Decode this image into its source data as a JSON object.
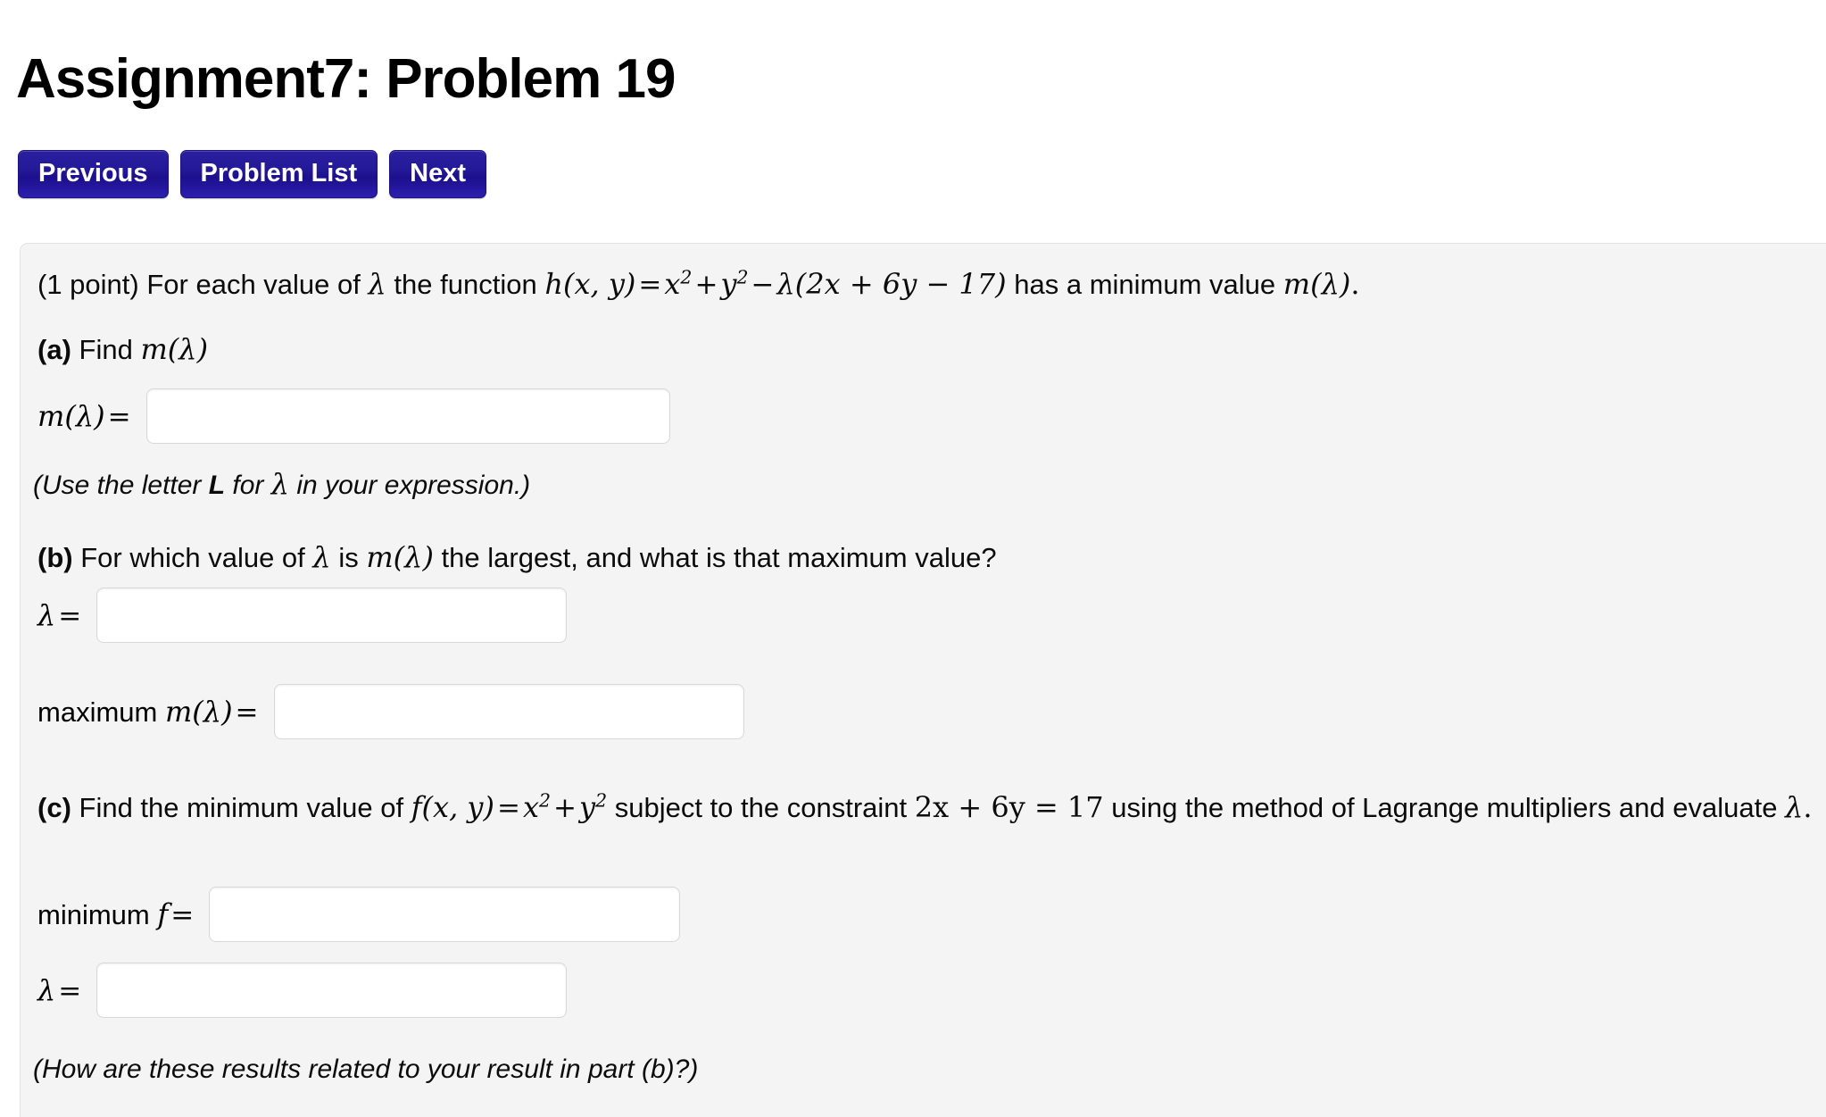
{
  "header": {
    "title": "Assignment7: Problem 19"
  },
  "nav": {
    "previous_label": "Previous",
    "problem_list_label": "Problem List",
    "next_label": "Next"
  },
  "problem": {
    "points": "(1 point)",
    "statement_pre": "For each value of",
    "statement_lambda": "λ",
    "statement_mid": "the function",
    "h_fn": "h(x, y)",
    "eq": "=",
    "x_sq_base": "x",
    "sq": "2",
    "plus": "+",
    "y_sq_base": "y",
    "minus": "−",
    "lambda_sym": "λ",
    "constraint_expr": "(2x + 6y − 17)",
    "statement_post": "has a minimum value",
    "m_lambda": "m(λ)",
    "period": ".",
    "parts": {
      "a": {
        "tag": "(a)",
        "prompt": "Find",
        "prompt_math": "m(λ)",
        "answer_label_math": "m(λ)",
        "answer_label_eq": "=",
        "answer_value": "",
        "note": "(Use the letter L for λ in your expression.)",
        "note_pre": "(Use the letter ",
        "note_bold": "L",
        "note_mid": " for ",
        "note_lambda": "λ",
        "note_post": " in your expression.)"
      },
      "b": {
        "tag": "(b)",
        "prompt_pre": "For which value of",
        "prompt_lambda": "λ",
        "prompt_is": "is",
        "prompt_m": "m(λ)",
        "prompt_post": "the largest, and what is that maximum value?",
        "lambda_label": "λ",
        "lambda_eq": "=",
        "lambda_value": "",
        "max_label_text": "maximum ",
        "max_label_math": "m(λ)",
        "max_label_eq": "=",
        "max_value": ""
      },
      "c": {
        "tag": "(c)",
        "prompt_pre": "Find the minimum value of",
        "f_fn": "f(x, y)",
        "f_eq": "=",
        "f_x": "x",
        "f_sq": "2",
        "f_plus": "+",
        "f_y": "y",
        "prompt_mid": "subject to the constraint",
        "constraint": "2x + 6y = 17",
        "prompt_post": "using the method of Lagrange multipliers and evaluate",
        "prompt_lambda": "λ",
        "prompt_period": ".",
        "min_label_text": "minimum ",
        "min_label_math": "f",
        "min_label_eq": "=",
        "min_value": "",
        "lambda_label": "λ",
        "lambda_eq": "=",
        "lambda_value": "",
        "note": "(How are these results related to your result in part (b)?)"
      }
    }
  },
  "colors": {
    "button_bg": "#241a99",
    "button_border": "#1c1380",
    "panel_bg": "#f4f4f4",
    "panel_border": "#e2e2e2",
    "input_border": "#d8d8d8",
    "text": "#0b0b0b"
  }
}
